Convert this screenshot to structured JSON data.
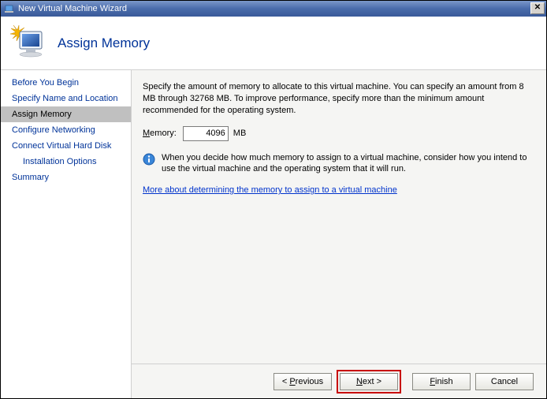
{
  "title": "New Virtual Machine Wizard",
  "header": {
    "title": "Assign Memory"
  },
  "sidebar": {
    "items": [
      {
        "label": "Before You Begin"
      },
      {
        "label": "Specify Name and Location"
      },
      {
        "label": "Assign Memory"
      },
      {
        "label": "Configure Networking"
      },
      {
        "label": "Connect Virtual Hard Disk"
      },
      {
        "label": "Installation Options"
      },
      {
        "label": "Summary"
      }
    ]
  },
  "content": {
    "description": "Specify the amount of memory to allocate to this virtual machine. You can specify an amount from 8 MB through 32768 MB. To improve performance, specify more than the minimum amount recommended for the operating system.",
    "memory_label_m": "M",
    "memory_label_rest": "emory:",
    "memory_value": "4096",
    "memory_unit": "MB",
    "info_text": "When you decide how much memory to assign to a virtual machine, consider how you intend to use the virtual machine and the operating system that it will run.",
    "link_text": "More about determining the memory to assign to a virtual machine"
  },
  "footer": {
    "previous_lt": "< ",
    "previous_p": "P",
    "previous_rest": "revious",
    "next_n": "N",
    "next_rest": "ext >",
    "finish_f": "F",
    "finish_rest": "inish",
    "cancel": "Cancel"
  }
}
